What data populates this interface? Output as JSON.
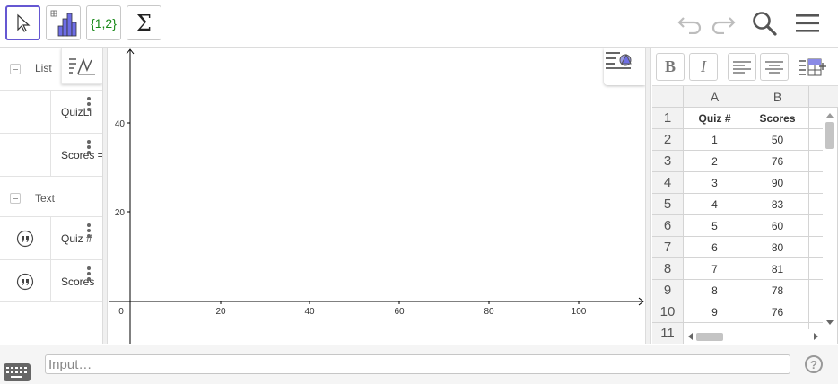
{
  "toolbar": {
    "tools": [
      {
        "name": "move-tool",
        "icon": "cursor-arrow-icon"
      },
      {
        "name": "spreadsheet-chart-tool",
        "icon": "bar-chart-icon"
      },
      {
        "name": "create-list-tool",
        "icon": "list-braces-icon",
        "label": "{1,2}"
      },
      {
        "name": "sum-tool",
        "icon": "sigma-icon",
        "label": "Σ"
      }
    ],
    "right_icons": [
      "undo-icon",
      "redo-icon",
      "search-icon",
      "hamburger-menu-icon"
    ]
  },
  "algebra": {
    "groups": [
      {
        "label": "List",
        "items": [
          {
            "text": "QuizLi"
          },
          {
            "text": "Scores ="
          }
        ]
      },
      {
        "label": "Text",
        "items": [
          {
            "text": "Quiz #"
          },
          {
            "text": "Scores"
          }
        ]
      }
    ]
  },
  "graphics": {
    "x_ticks": [
      "0",
      "20",
      "40",
      "60",
      "80",
      "100"
    ],
    "y_ticks": [
      "20",
      "40"
    ],
    "axis_color": "#000000"
  },
  "spreadsheet": {
    "columns": [
      "A",
      "B"
    ],
    "rows": [
      {
        "n": "1",
        "a": "Quiz #",
        "b": "Scores",
        "header": true
      },
      {
        "n": "2",
        "a": "1",
        "b": "50"
      },
      {
        "n": "3",
        "a": "2",
        "b": "76"
      },
      {
        "n": "4",
        "a": "3",
        "b": "90"
      },
      {
        "n": "5",
        "a": "4",
        "b": "83"
      },
      {
        "n": "6",
        "a": "5",
        "b": "60"
      },
      {
        "n": "7",
        "a": "6",
        "b": "80"
      },
      {
        "n": "8",
        "a": "7",
        "b": "81"
      },
      {
        "n": "9",
        "a": "8",
        "b": "78"
      },
      {
        "n": "10",
        "a": "9",
        "b": "76"
      },
      {
        "n": "11",
        "a": "",
        "b": ""
      }
    ],
    "buttons": {
      "bold": "B",
      "italic": "I"
    }
  },
  "inputbar": {
    "placeholder": "Input…",
    "help": "?"
  },
  "colors": {
    "accent": "#6557d2",
    "list_tool_green": "#1a8a1a",
    "bar_chart_purple": "#6e6ee6"
  }
}
